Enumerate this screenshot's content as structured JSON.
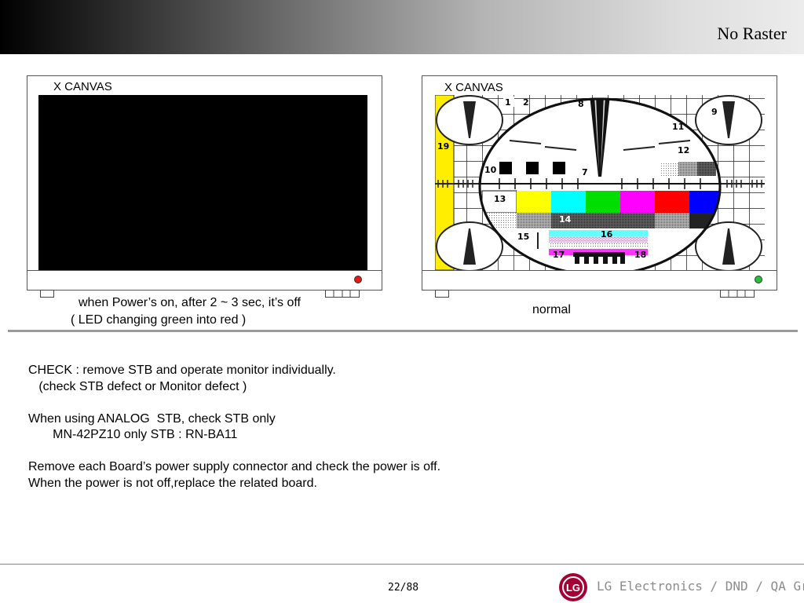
{
  "header": {
    "title": "No Raster"
  },
  "left_monitor": {
    "canvas_label": "Χ CANVAS",
    "led_color": "#e21a1a",
    "caption_line1": "when Power’s on,  after 2 ~ 3 sec, it’s off",
    "caption_line2": "( LED changing green into red )"
  },
  "right_monitor": {
    "canvas_label": "Χ CANVAS",
    "led_color": "#22c33a",
    "caption": "normal",
    "pattern_labels": [
      "1",
      "2",
      "8",
      "9",
      "11",
      "12",
      "19",
      "10",
      "7",
      "13",
      "14",
      "15",
      "16",
      "17",
      "18"
    ],
    "color_bars": [
      "#ffff00",
      "#00ffff",
      "#00dd00",
      "#ff00ff",
      "#ff0000",
      "#0000ff"
    ]
  },
  "notes": {
    "line1": "CHECK : remove STB and operate monitor individually.",
    "line2": "   (check STB defect or Monitor defect )",
    "line3": "When using ANALOG  STB, check STB only",
    "line4": "       MN-42PZ10 only STB : RN-BA11",
    "line5": "Remove each Board’s power supply connector and check the power is off.",
    "line6": "When the power is not off,replace the related board."
  },
  "footer": {
    "page": "22/88",
    "logo_text": "LG",
    "company": "LG Electronics / DND / QA Gr."
  },
  "colors": {
    "lg_logo": "#a50034"
  }
}
